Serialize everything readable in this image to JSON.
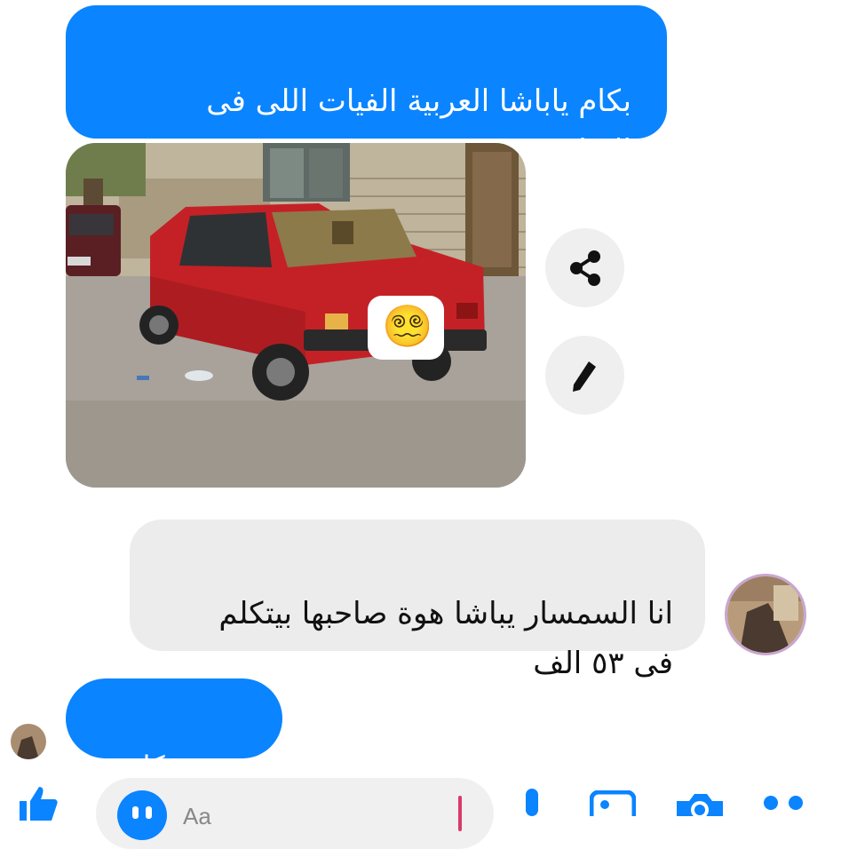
{
  "messages": {
    "sent_1": "بكام ياباشا العربية الفيات اللى فى\nالاعلان دى",
    "received_1": "انا السمسار يباشا هوة صاحبها بيتكلم\nفى ٥٣ الف",
    "sent_2": "سيبه يتكلم"
  },
  "photo": {
    "emoji": "😵‍💫",
    "alt": "red car photo"
  },
  "composer": {
    "placeholder": "Aa"
  },
  "icons": {
    "share": "share-icon",
    "edit": "pencil-icon",
    "like": "thumbs-up-icon",
    "emoji": "emoji-icon",
    "mic": "microphone-icon",
    "gallery": "gallery-icon",
    "camera": "camera-icon",
    "menu": "dots-icon"
  },
  "colors": {
    "sent_bubble": "#0a84ff",
    "received_bubble": "#ececec",
    "accent": "#0a84ff"
  }
}
